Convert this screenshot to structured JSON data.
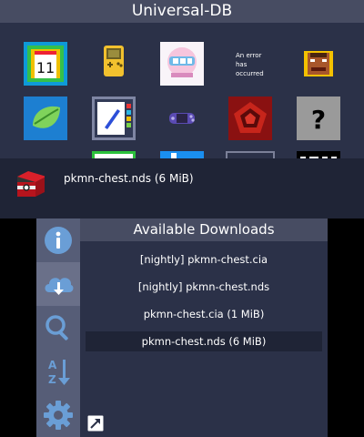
{
  "top": {
    "title": "Universal-DB",
    "error_tile_text": [
      "An error",
      "has",
      "occurred"
    ],
    "number_tile_text": "11",
    "question_tile_text": "?",
    "selected_caption": "pkmn-chest.nds (6 MiB)"
  },
  "bottom": {
    "panel_title": "Available Downloads",
    "downloads": [
      "[nightly] pkmn-chest.cia",
      "[nightly] pkmn-chest.nds",
      "pkmn-chest.cia (1 MiB)",
      "pkmn-chest.nds (6 MiB)"
    ],
    "selected_index": 3,
    "sidebar": [
      {
        "name": "info-icon"
      },
      {
        "name": "cloud-download-icon"
      },
      {
        "name": "search-icon"
      },
      {
        "name": "sort-az-icon"
      },
      {
        "name": "gear-icon"
      }
    ],
    "active_sidebar_index": 1
  },
  "colors": {
    "background": "#2b3148",
    "bar": "#474c62",
    "sidebar": "#565d77",
    "selection": "#1f2436"
  }
}
